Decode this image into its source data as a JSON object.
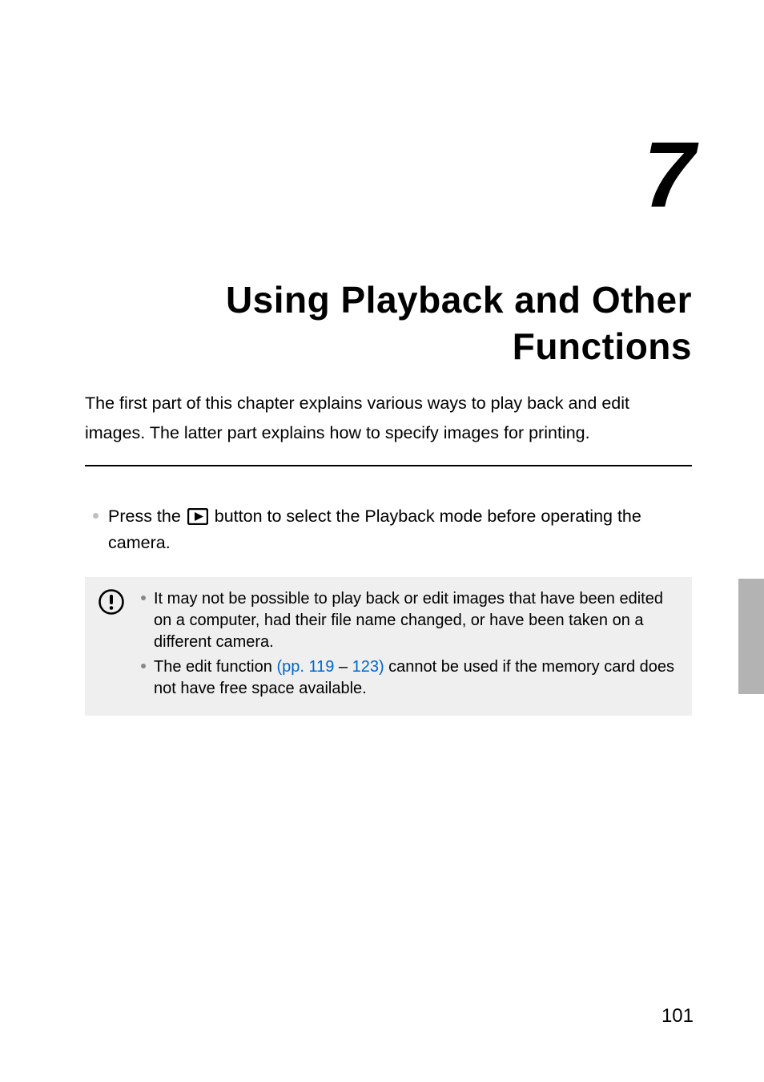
{
  "chapter": {
    "number": "7",
    "title": "Using Playback and Other Functions"
  },
  "intro": "The first part of this chapter explains various ways to play back and edit images. The latter part explains how to specify images for printing.",
  "press_line": {
    "pre": "Press the ",
    "post": " button to select the Playback mode before operating the camera."
  },
  "callout": {
    "item1": "It may not be possible to play back or edit images that have been edited on a computer, had their file name changed, or have been taken on a different camera.",
    "item2_pre": "The edit function ",
    "item2_link1": "(pp. 119",
    "item2_mid": " – ",
    "item2_link2": "123)",
    "item2_post": " cannot be used if the memory card does not have free space available."
  },
  "page_number": "101"
}
